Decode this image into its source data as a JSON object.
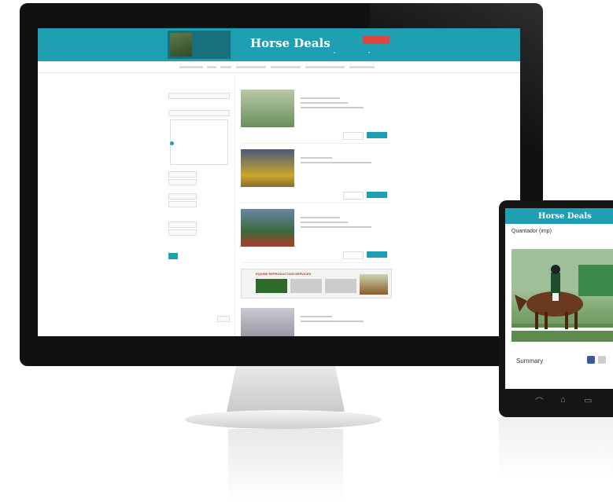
{
  "site": {
    "logo": "Horse Deals",
    "promo_text": "",
    "place_ad": "",
    "sign_in": "",
    "saved": ""
  },
  "nav": [],
  "sidebar": {
    "title": "",
    "clear_link": "",
    "labels": [],
    "list_items": []
  },
  "results": {
    "sort": "",
    "listings": [
      {
        "title": "",
        "price": ""
      },
      {
        "title": "",
        "price": ""
      },
      {
        "title": "",
        "price": ""
      },
      {
        "title": "",
        "price": ""
      }
    ],
    "banner_title": "EQUINE REPRODUCTION SERVICES"
  },
  "tablet": {
    "back": "",
    "logo": "Horse Deals",
    "title": "Quantador (imp)",
    "price": "",
    "summary": "Summary",
    "breed": "",
    "height": ""
  },
  "colors": {
    "brand": "#1f9fb2",
    "place_ad": "#e0443e"
  },
  "icons": [
    "user-icon",
    "heart-icon",
    "facebook-icon",
    "share-icon",
    "back-icon",
    "home-icon",
    "recent-apps-icon"
  ]
}
